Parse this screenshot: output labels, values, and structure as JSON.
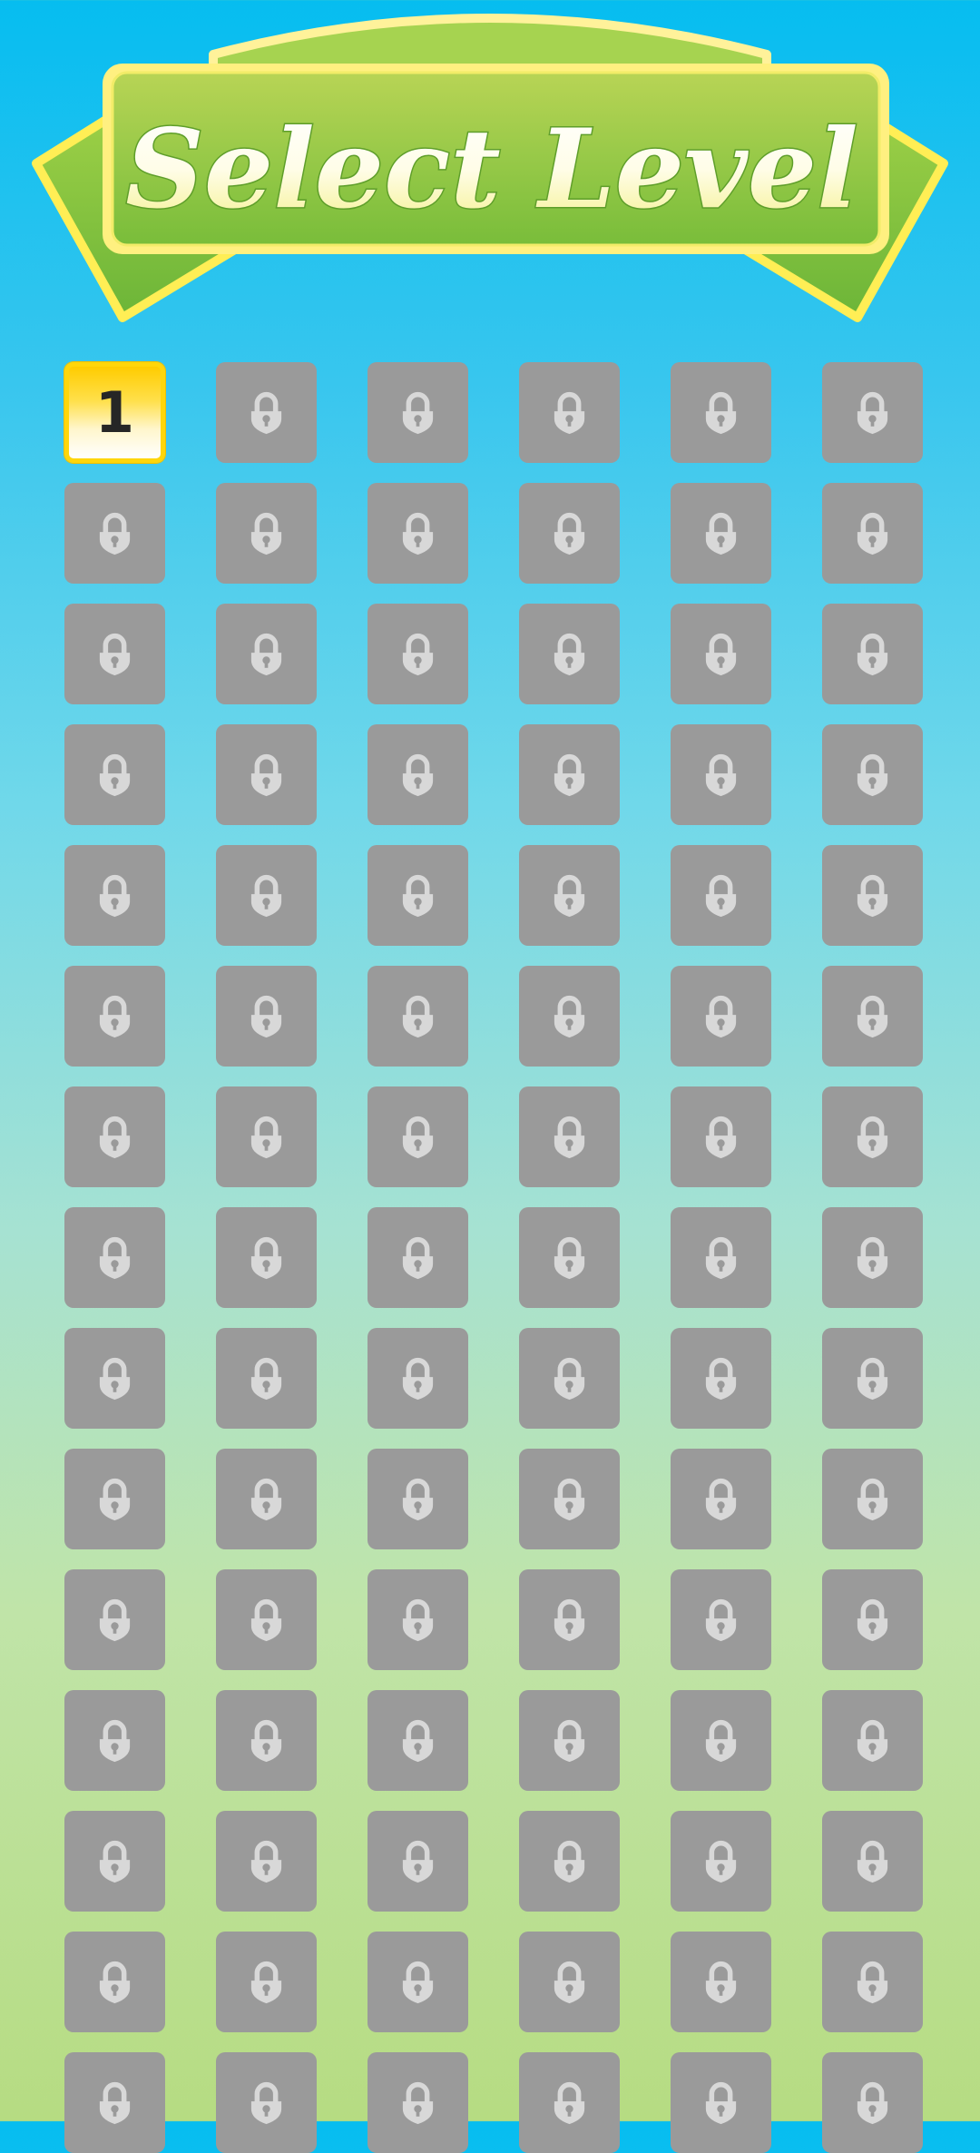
{
  "header": {
    "title": "Select Level"
  },
  "levels": {
    "unlocked": [
      "1"
    ],
    "locked_count": 89,
    "lock_icon": "lock-icon"
  },
  "colors": {
    "banner_green": "#8cc63f",
    "banner_border": "#ffe94d",
    "tile_locked": "#9a9a9a",
    "tile_unlocked": "#ffd60a",
    "lock": "#d8d8d8"
  }
}
